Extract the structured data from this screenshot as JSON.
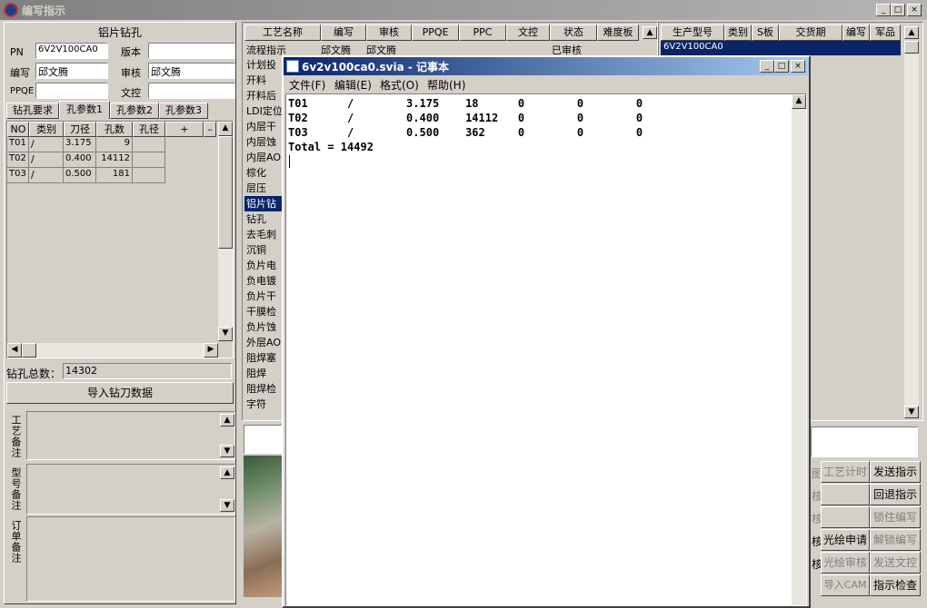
{
  "main": {
    "title": "编写指示"
  },
  "left": {
    "section_title": "铝片钻孔",
    "pn_label": "PN",
    "pn_value": "6V2V100CA0",
    "version_label": "版本",
    "version_value": "",
    "writer_label": "编写",
    "writer_value": "邱文腾",
    "reviewer_label": "审核",
    "reviewer_value": "邱文腾",
    "ppqe_label": "PPQE",
    "ppqe_value": "",
    "doc_control_label": "文控",
    "doc_control_value": "",
    "tabs": [
      "钻孔要求",
      "孔参数1",
      "孔参数2",
      "孔参数3"
    ],
    "grid_headers": [
      "NO",
      "类别",
      "刀径",
      "孔数",
      "孔径",
      "+",
      "–"
    ],
    "grid_rows": [
      [
        "T01",
        "/",
        "3.175",
        "9",
        ""
      ],
      [
        "T02",
        "/",
        "0.400",
        "14112",
        ""
      ],
      [
        "T03",
        "/",
        "0.500",
        "181",
        ""
      ]
    ],
    "total_label": "钻孔总数：",
    "total_value": "14302",
    "import_button": "导入钻刀数据",
    "process_note_label": "工艺备注",
    "model_note_label": "型号备注",
    "order_note_label": "订单备注"
  },
  "middle": {
    "headers": [
      "工艺名称",
      "编写",
      "审核",
      "PPQE",
      "PPC",
      "文控",
      "状态",
      "难度板"
    ],
    "first_row": [
      "流程指示",
      "邱文腾",
      "邱文腾",
      "",
      "",
      "",
      "已审核",
      ""
    ],
    "process_items": [
      "计划投",
      "开料",
      "开料后",
      "LDI定位",
      "内层干",
      "内层蚀",
      "内层AO",
      "棕化",
      "层压",
      "铝片钻",
      "钻孔",
      "去毛刺",
      "沉铜",
      "负片电",
      "负电镀",
      "负片干",
      "干膜检",
      "负片蚀",
      "外层AO",
      "阻焊塞",
      "阻焊",
      "阻焊检",
      "字符"
    ]
  },
  "right": {
    "headers": [
      "生产型号",
      "类别",
      "S板",
      "交货期",
      "编写",
      "军品"
    ],
    "row": [
      "6V2V100CA0",
      "",
      "",
      "",
      "",
      ""
    ],
    "buttons": [
      {
        "label": "工艺计时",
        "enabled": false
      },
      {
        "label": "发送指示",
        "enabled": true
      },
      {
        "label": "",
        "enabled": false
      },
      {
        "label": "回退指示",
        "enabled": true
      },
      {
        "label": "",
        "enabled": false
      },
      {
        "label": "锁住编写",
        "enabled": false
      },
      {
        "label": "光绘申请",
        "enabled": true
      },
      {
        "label": "解锁编写",
        "enabled": false
      },
      {
        "label": "光绘审核",
        "enabled": false
      },
      {
        "label": "发送文控",
        "enabled": false
      },
      {
        "label": "导入CAM",
        "enabled": false
      },
      {
        "label": "指示检查",
        "enabled": true
      }
    ],
    "partial_labels": [
      "图",
      "核",
      "核",
      "核",
      "核"
    ]
  },
  "notepad": {
    "title": "6v2v100ca0.svia - 记事本",
    "menu": [
      "文件(F)",
      "编辑(E)",
      "格式(O)",
      "帮助(H)"
    ],
    "lines": [
      "T01      /        3.175    18      0        0        0",
      "T02      /        0.400    14112   0        0        0",
      "T03      /        0.500    362     0        0        0",
      "Total = 14492"
    ]
  },
  "colors": {
    "title_active": "#0a246a",
    "title_inactive": "#808080",
    "selection": "#0a246a",
    "face": "#d4d0c8"
  }
}
